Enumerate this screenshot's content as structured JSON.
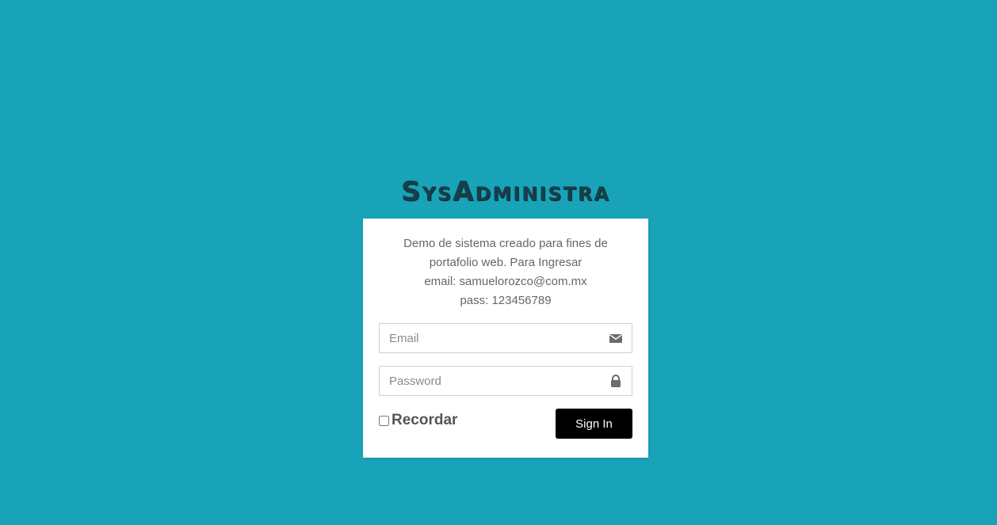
{
  "brand": {
    "title": "SysAdministra"
  },
  "info": {
    "line1": "Demo de sistema creado para fines de",
    "line2": "portafolio web. Para Ingresar",
    "line3": "email: samuelorozco@com.mx",
    "line4": "pass: 123456789"
  },
  "form": {
    "email": {
      "value": "",
      "placeholder": "Email",
      "icon": "envelope-icon"
    },
    "password": {
      "value": "",
      "placeholder": "Password",
      "icon": "lock-icon"
    },
    "remember": {
      "label": "Recordar",
      "checked": false
    },
    "submit_label": "Sign In"
  },
  "colors": {
    "background": "#18a3b8",
    "card": "#ffffff",
    "button": "#000000",
    "brand_text": "#173e4a"
  }
}
